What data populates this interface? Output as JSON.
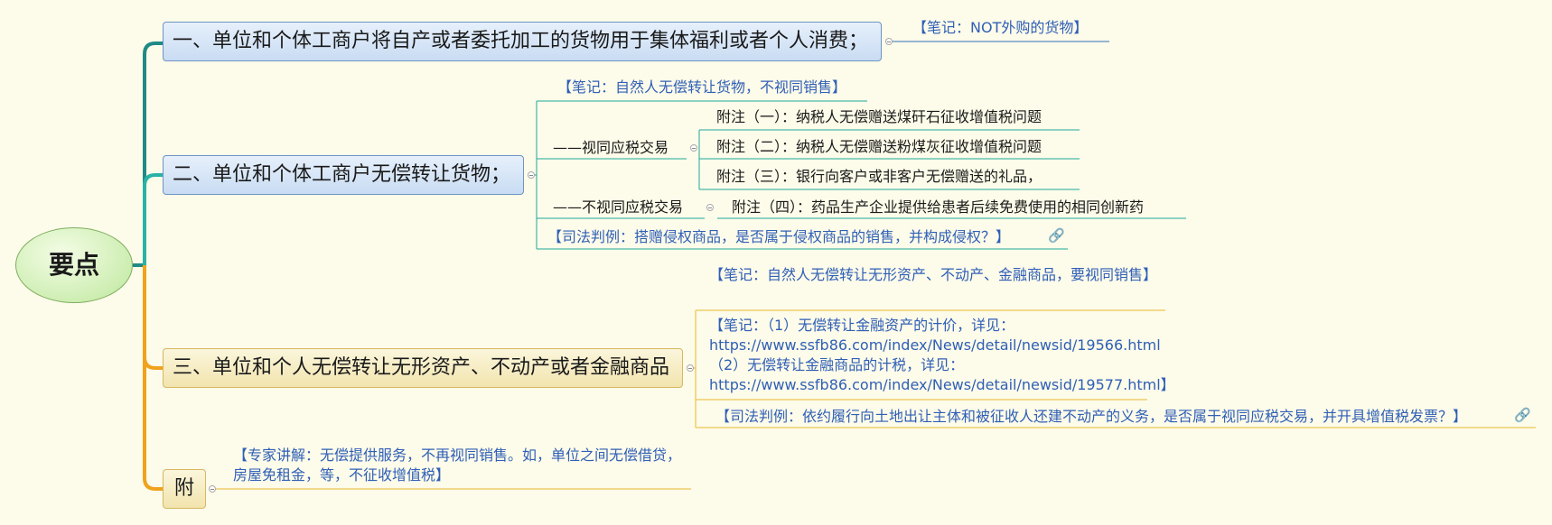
{
  "root": {
    "label": "要点"
  },
  "branches": {
    "b1": {
      "label": "一、单位和个体工商户将自产或者委托加工的货物用于集体福利或者个人消费；",
      "note": "【笔记：NOT外购的货物】"
    },
    "b2": {
      "label": "二、单位和个体工商户无偿转让货物；",
      "note": "【笔记：自然人无偿转让货物，不视同销售】",
      "sub1": {
        "label": "——视同应税交易",
        "items": [
          "附注（一）：纳税人无偿赠送煤矸石征收增值税问题",
          "附注（二）：纳税人无偿赠送粉煤灰征收增值税问题",
          "附注（三）：银行向客户或非客户无偿赠送的礼品，"
        ]
      },
      "sub2": {
        "label": "——不视同应税交易",
        "items": [
          "附注（四）：药品生产企业提供给患者后续免费使用的相同创新药"
        ]
      },
      "case": "【司法判例：搭赠侵权商品，是否属于侵权商品的销售，并构成侵权？】"
    },
    "b3": {
      "label": "三、单位和个人无偿转让无形资产、不动产或者金融商品",
      "note1": "【笔记：自然人无偿转让无形资产、不动产、金融商品，要视同销售】",
      "note2": "【笔记：（1）无偿转让金融资产的计价，详见：https://www.ssfb86.com/index/News/detail/newsid/19566.html （2）无偿转让金融商品的计税，详见：https://www.ssfb86.com/index/News/detail/newsid/19577.html】",
      "case": "【司法判例：依约履行向土地出让主体和被征收人还建不动产的义务，是否属于视同应税交易，并开具增值税发票？】"
    },
    "b4": {
      "label": "附",
      "note": "【专家讲解：无偿提供服务，不再视同销售。如，单位之间无偿借贷，房屋免租金，等，不征收增值税】"
    }
  },
  "colors": {
    "branch1": "#1f8a86",
    "branch2": "#28b3a6",
    "branch3": "#f0a21c",
    "branch4": "#f0a21c",
    "note": "#2f5fb7"
  }
}
